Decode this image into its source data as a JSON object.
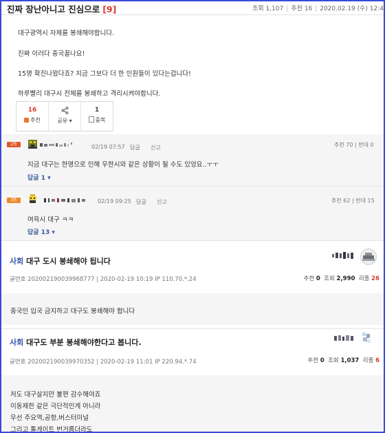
{
  "post": {
    "title": "진짜 장난아니고 진심으로",
    "comment_count": "[9]",
    "views_label": "조회",
    "views": "1,107",
    "recommend_label": "추천",
    "recommend": "16",
    "datetime": "2020.02.19 (수) 12:4",
    "body": [
      "대구광역시 자체를 봉쇄해야합니다.",
      "진짜 이러다 중국꼴나요!",
      "15명 확진나왔다죠? 지금 그보다 더 한 인원들이 있다는겁니다!",
      "하루빨리 대구시 전체를 봉쇄하고 격리시켜야합니다."
    ],
    "votes": {
      "recommend_count": "16",
      "recommend_label": "추천",
      "share_label": "공유",
      "scrap_count": "1",
      "scrap_label": "중복"
    }
  },
  "comments": [
    {
      "rank": "2등",
      "date": "02/19 07:57",
      "reply_label": "답글",
      "report_label": "신고",
      "vote": "추천 70",
      "oppose": "반대 0",
      "text": "지금 대구는 한명으로 인해 우한시와 같은 상황이 될 수도 있엉요..ㅜㅜ",
      "replies": "답글 1"
    },
    {
      "rank": "3등",
      "date": "02/19 09:25",
      "reply_label": "답글",
      "report_label": "신고",
      "vote": "추천 62",
      "oppose": "반대 15",
      "text": "여윽시 대구 ㅋㅋ",
      "replies": "답글 13"
    }
  ],
  "items": [
    {
      "category": "사회",
      "title": "대구 도시 봉쇄해야 됩니다",
      "meta": "글번호  202002190039968777 | 2020-02-19 10:19     IP 110.70.*.24",
      "rec_label": "추천",
      "rec": "0",
      "view_label": "조회",
      "views": "2,990",
      "reply_label": "리플",
      "replies": "26",
      "body": [
        "중국인 입국 금지하고 대구도 봉쇄해야 합니다"
      ]
    },
    {
      "category": "사회",
      "title": "대구도 부분 봉쇄해야한다고 봅니다.",
      "meta": "글번호  202002190039970352 | 2020-02-19 11:01     IP 220.94.*.74",
      "rec_label": "추천",
      "rec": "0",
      "view_label": "조회",
      "views": "1,037",
      "reply_label": "리플",
      "replies": "6",
      "body": [
        "저도 대구살지만 불편 감수해야죠",
        "이동제한 같은 극단적인게 아니라",
        "우선 주요역,공항,버스터미널",
        "그리고 톨게이트 번거롭더라도"
      ]
    }
  ],
  "colors": {
    "accent_red": "#d9392f",
    "category_blue": "#3a5aa9",
    "frame_blue": "#3a48d6"
  }
}
